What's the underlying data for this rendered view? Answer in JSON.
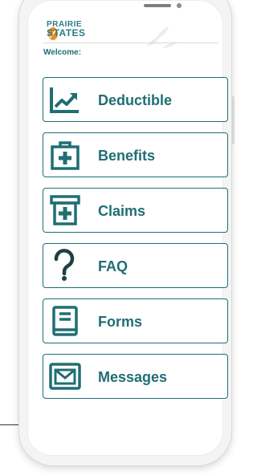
{
  "brand": {
    "line1": "PRAIRIE",
    "line2": "STATES",
    "accent": "#1f6f74",
    "logo_orange": "#f28c1e"
  },
  "header": {
    "welcome": "Welcome:"
  },
  "menu": [
    {
      "label": "Deductible",
      "icon": "chart-trending-up-icon"
    },
    {
      "label": "Benefits",
      "icon": "medical-kit-icon"
    },
    {
      "label": "Claims",
      "icon": "medicine-box-icon"
    },
    {
      "label": "FAQ",
      "icon": "question-mark-icon"
    },
    {
      "label": "Forms",
      "icon": "book-icon"
    },
    {
      "label": "Messages",
      "icon": "envelope-icon"
    }
  ]
}
